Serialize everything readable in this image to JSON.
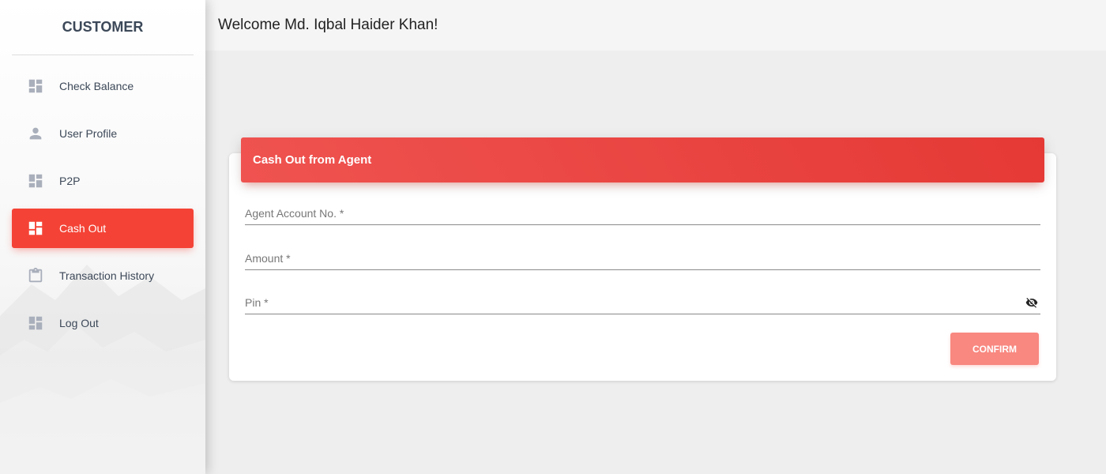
{
  "sidebar": {
    "brand": "CUSTOMER",
    "items": [
      {
        "label": "Check Balance",
        "icon": "dashboard-icon",
        "active": false
      },
      {
        "label": "User Profile",
        "icon": "person-icon",
        "active": false
      },
      {
        "label": "P2P",
        "icon": "dashboard-icon",
        "active": false
      },
      {
        "label": "Cash Out",
        "icon": "dashboard-icon",
        "active": true
      },
      {
        "label": "Transaction History",
        "icon": "clipboard-icon",
        "active": false
      },
      {
        "label": "Log Out",
        "icon": "dashboard-icon",
        "active": false
      }
    ]
  },
  "header": {
    "welcome": "Welcome Md. Iqbal Haider Khan!"
  },
  "form": {
    "title": "Cash Out from Agent",
    "fields": [
      {
        "label": "Agent Account No. *",
        "value": ""
      },
      {
        "label": "Amount *",
        "value": ""
      },
      {
        "label": "Pin *",
        "value": "",
        "icon": "visibility-off-icon"
      }
    ],
    "confirm_label": "CONFIRM"
  },
  "colors": {
    "accent": "#f44336",
    "header_gradient_start": "#ef5350",
    "header_gradient_end": "#e53935",
    "confirm_button": "#f88880",
    "page_background": "#eeeeee"
  }
}
